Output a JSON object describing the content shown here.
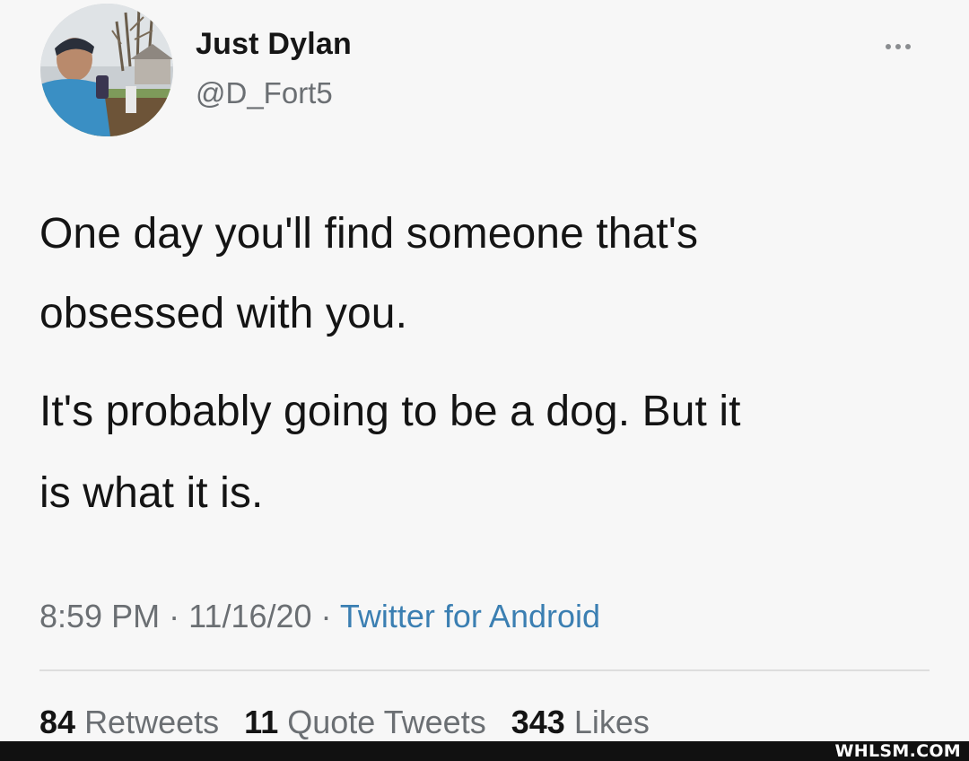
{
  "author": {
    "display_name": "Just Dylan",
    "handle": "@D_Fort5"
  },
  "more_icon": "ellipsis-icon",
  "tweet_text": {
    "line1": "One day you'll find someone that's",
    "line2": "obsessed with you.",
    "line3": "It's probably going to be a dog. But it",
    "line4": "is what it is."
  },
  "meta": {
    "time": "8:59 PM",
    "separator1": " · ",
    "date": "11/16/20",
    "separator2": " · ",
    "source": "Twitter for Android"
  },
  "stats": {
    "retweets_count": "84",
    "retweets_label": "Retweets",
    "quotes_count": "11",
    "quotes_label": "Quote Tweets",
    "likes_count": "343",
    "likes_label": "Likes"
  },
  "watermark": "WHLSM.COM",
  "colors": {
    "source_link": "#3b7fb2",
    "secondary_text": "#6b6f73",
    "bottom_bar": "#111111"
  }
}
